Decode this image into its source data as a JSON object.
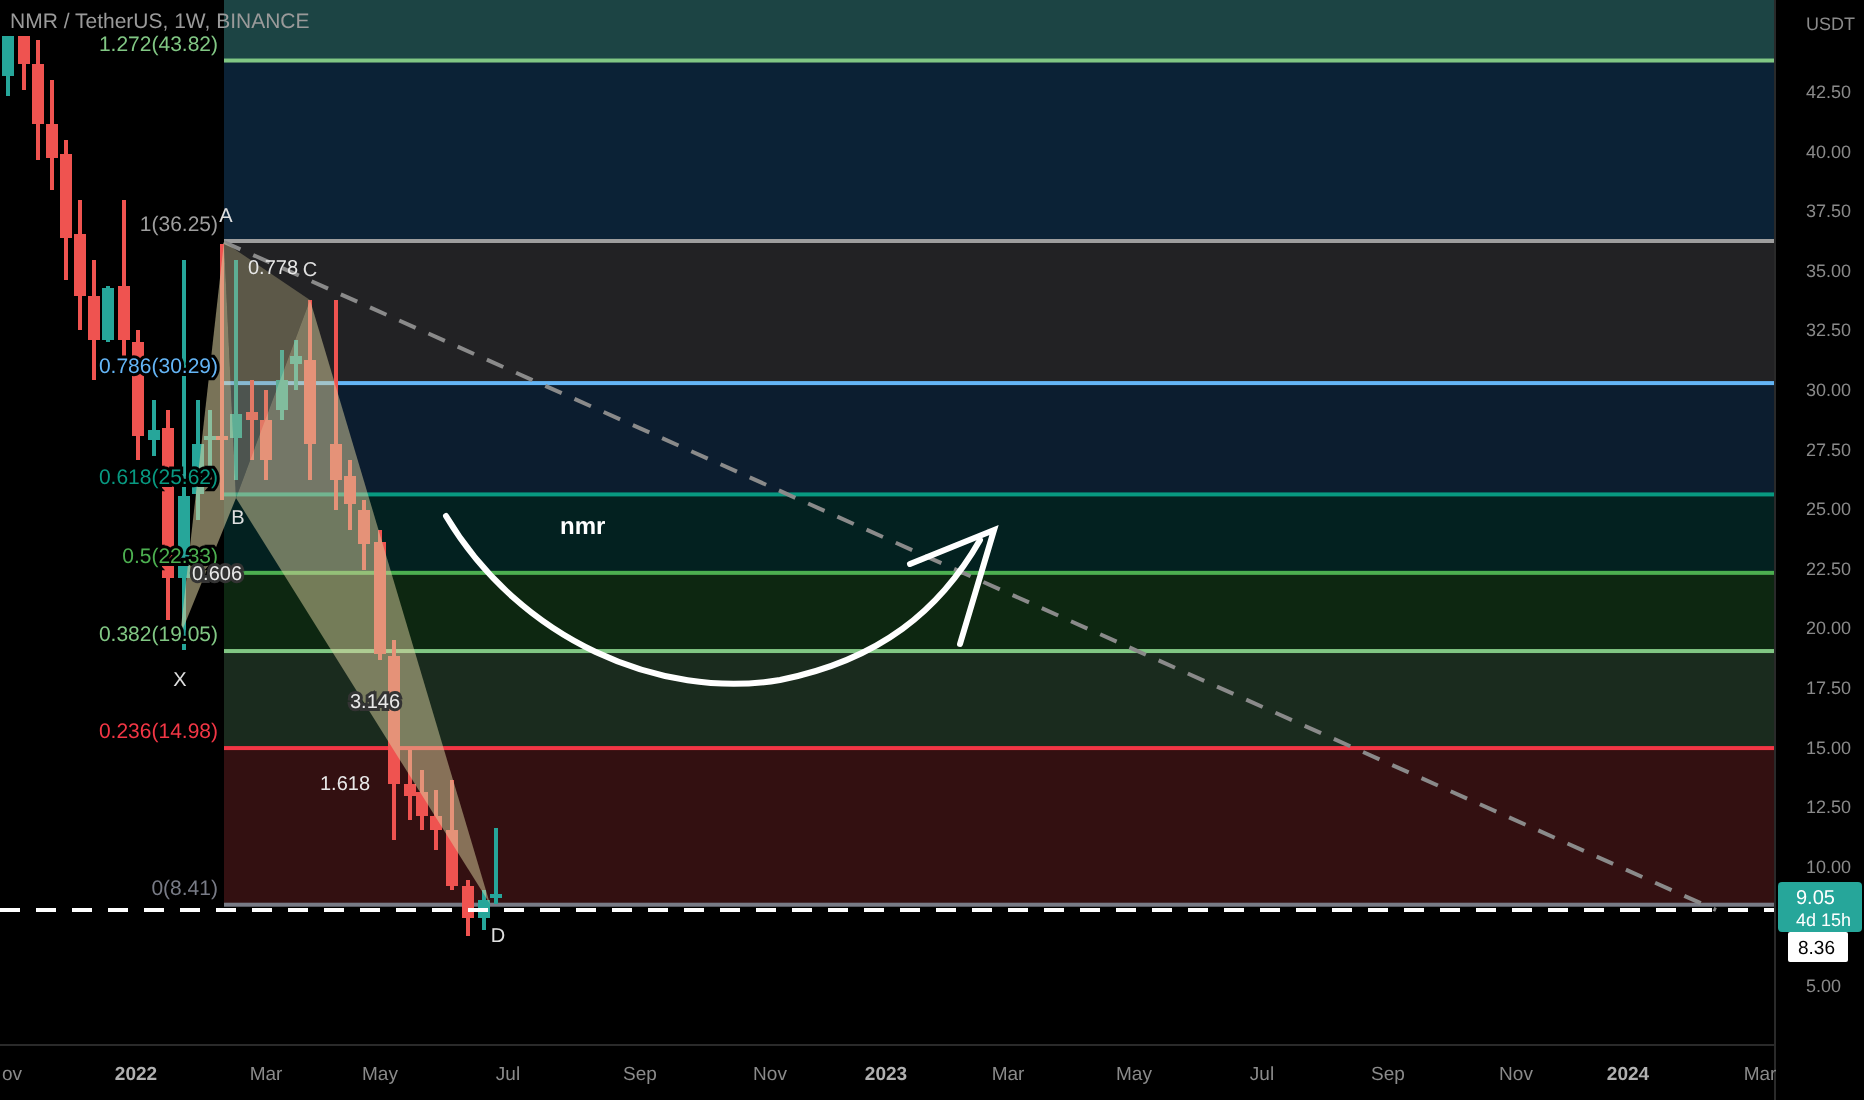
{
  "chart_title": "NMR / TetherUS, 1W, BINANCE",
  "fib_levels": [
    {
      "label": "1.272(43.82)",
      "color": "#81c784"
    },
    {
      "label": "1(36.25)",
      "color": "#9e9e9e"
    },
    {
      "label": "0.786(30.29)",
      "color": "#64b5f6"
    },
    {
      "label": "0.618(25.62)",
      "color": "#089981"
    },
    {
      "label": "0.5(22.33)",
      "color": "#4caf50"
    },
    {
      "label": "0.382(19.05)",
      "color": "#81c784"
    },
    {
      "label": "0.236(14.98)",
      "color": "#f23645"
    },
    {
      "label": "0(8.41)",
      "color": "#787b86"
    }
  ],
  "pattern_points": [
    "X",
    "A",
    "B",
    "C",
    "D"
  ],
  "pattern_ratios": [
    "0.778",
    "0.606",
    "3.146",
    "1.618"
  ],
  "annotation": "nmr",
  "price_axis": {
    "unit": "USDT",
    "ticks": [
      "42.50",
      "40.00",
      "37.50",
      "35.00",
      "32.50",
      "30.00",
      "27.50",
      "25.00",
      "22.50",
      "20.00",
      "17.50",
      "15.00",
      "12.50",
      "10.00",
      "5.00"
    ]
  },
  "last_price": {
    "price": "9.05",
    "countdown": "4d 15h"
  },
  "marker_price": "8.36",
  "time_axis": [
    {
      "label": "ov",
      "kind": "month"
    },
    {
      "label": "2022",
      "kind": "year"
    },
    {
      "label": "Mar",
      "kind": "month"
    },
    {
      "label": "May",
      "kind": "month"
    },
    {
      "label": "Jul",
      "kind": "month"
    },
    {
      "label": "Sep",
      "kind": "month"
    },
    {
      "label": "Nov",
      "kind": "month"
    },
    {
      "label": "2023",
      "kind": "year"
    },
    {
      "label": "Mar",
      "kind": "month"
    },
    {
      "label": "May",
      "kind": "month"
    },
    {
      "label": "Jul",
      "kind": "month"
    },
    {
      "label": "Sep",
      "kind": "month"
    },
    {
      "label": "Nov",
      "kind": "month"
    },
    {
      "label": "2024",
      "kind": "year"
    },
    {
      "label": "Mar",
      "kind": "month"
    }
  ]
}
